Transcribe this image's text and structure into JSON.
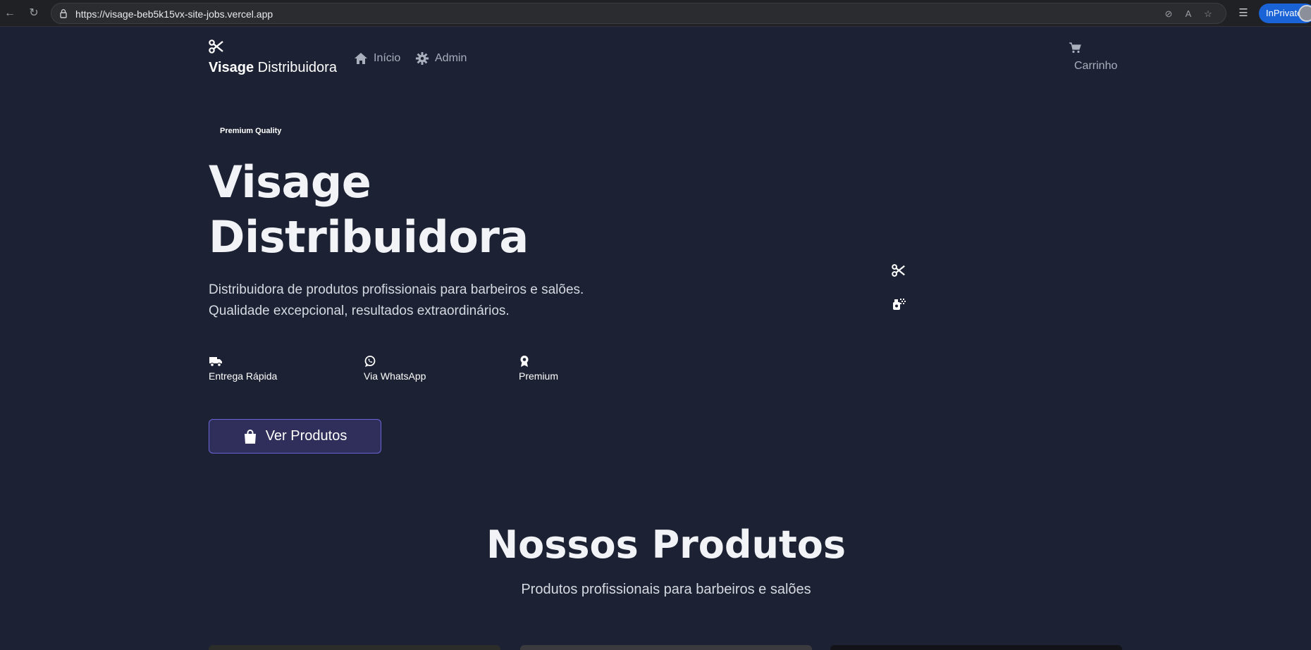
{
  "browser": {
    "url": "https://visage-beb5k15vx-site-jobs.vercel.app",
    "inprivate_label": "InPrivate"
  },
  "header": {
    "brand_bold": "Visage",
    "brand_rest": " Distribuidora",
    "nav": [
      {
        "label": "Início",
        "icon": "home-icon"
      },
      {
        "label": "Admin",
        "icon": "gear-icon"
      }
    ],
    "cart_label": "Carrinho"
  },
  "hero": {
    "badge": "Premium Quality",
    "title_line1": "Visage",
    "title_line2": "Distribuidora",
    "description_line1": "Distribuidora de produtos profissionais para barbeiros e salões.",
    "description_line2": "Qualidade excepcional, resultados extraordinários.",
    "features": [
      {
        "label": "Entrega Rápida",
        "icon": "truck-icon"
      },
      {
        "label": "Via WhatsApp",
        "icon": "whatsapp-icon"
      },
      {
        "label": "Premium",
        "icon": "award-icon"
      }
    ],
    "cta_label": "Ver Produtos"
  },
  "products": {
    "title": "Nossos Produtos",
    "subtitle": "Produtos profissionais para barbeiros e salões"
  },
  "colors": {
    "background": "#1c2233",
    "cta_bg": "#302f5c",
    "cta_border": "#6b64d6",
    "nav_text": "#a9afbd"
  }
}
